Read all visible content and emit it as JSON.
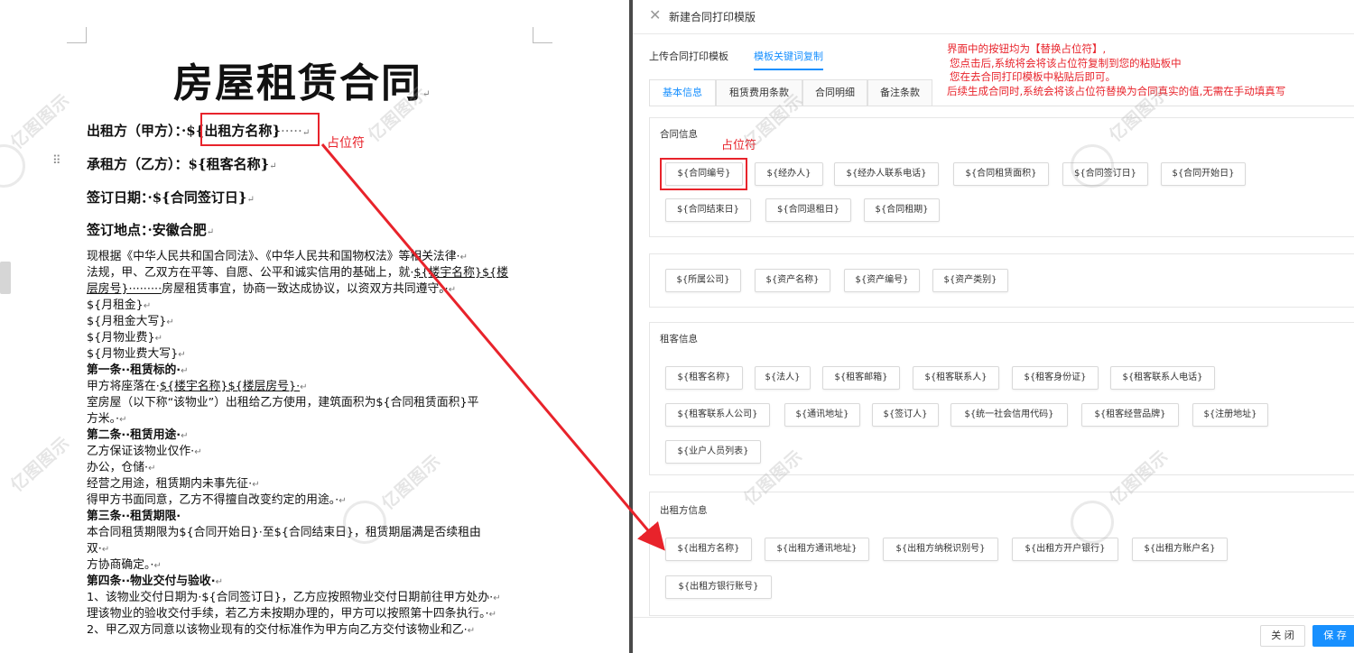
{
  "document": {
    "title": "房屋租赁合同",
    "para_mark": "↵",
    "drag_handle": "⠿",
    "lessor_label": "出租方（甲方）：",
    "lessor_value": "${出租方名称}",
    "lessor_dots": "·····",
    "lessee_label": "承租方（乙方）：",
    "lessee_value": "${租客名称}",
    "sign_date_label": "签订日期：",
    "sign_date_value": "${合同签订日}",
    "sign_place_label": "签订地点：",
    "sign_place_value": "安徽合肥",
    "placeholder_note": "占位符",
    "body": {
      "l1": "现根据《中华人民共和国合同法》、《中华人民共和国物权法》等相关法律·",
      "l2a": "法规，甲、乙双方在平等、自愿、公平和诚实信用的基础上，就·",
      "l2b": "${楼宇名称}${楼",
      "l3a": "层房号}·········",
      "l3b": "房屋租赁事宜，协商一致达成协议，以资双方共同遵守。·",
      "l4": "${月租金}",
      "l5": "${月租金大写}",
      "l6": "${月物业费}",
      "l7": "${月物业费大写}",
      "l8": "第一条··租赁标的·",
      "l9a": "甲方将座落在·",
      "l9b": "${楼宇名称}${楼层房号}·",
      "l10": "室房屋（以下称“该物业”）出租给乙方使用，建筑面积为${合同租赁面积}平",
      "l11": "方米。·",
      "l12": "第二条··租赁用途·",
      "l13": "乙方保证该物业仅作·",
      "l14": "办公，仓储·",
      "l15": "经营之用途，租赁期内未事先征·",
      "l16": "得甲方书面同意，乙方不得擅自改变约定的用途。·",
      "l17": "第三条··租赁期限·",
      "l18": "本合同租赁期限为${合同开始日}·至${合同结束日}，租赁期届满是否续租由",
      "l19": "双·",
      "l20": "方协商确定。·",
      "l21": "第四条··物业交付与验收·",
      "l22": "1、该物业交付日期为·${合同签订日}，乙方应按照物业交付日期前往甲方处办·",
      "l23": "理该物业的验收交付手续，若乙方未按期办理的，甲方可以按照第十四条执行。·",
      "l24": "2、甲乙双方同意以该物业现有的交付标准作为甲方向乙方交付该物业和乙·"
    }
  },
  "watermark": {
    "text": "亿图图示"
  },
  "dialog": {
    "close_icon": "✕",
    "title": "新建合同打印模版",
    "tabs": [
      "上传合同打印模板",
      "模板关键词复制"
    ],
    "note_lines": [
      "界面中的按钮均为【替换占位符】,",
      "您点击后,系统将会将该占位符复制到您的粘贴板中",
      "您在去合同打印模板中粘贴后即可。",
      "后续生成合同时,系统会将该占位符替换为合同真实的值,无需在手动填真写"
    ],
    "subtabs": [
      "基本信息",
      "租赁费用条款",
      "合同明细",
      "备注条款"
    ],
    "placeholder_note": "占位符",
    "sections": {
      "contract": {
        "title": "合同信息",
        "chips": [
          "${合同编号}",
          "${经办人}",
          "${经办人联系电话}",
          "${合同租赁面积}",
          "${合同签订日}",
          "${合同开始日}",
          "${合同结束日}",
          "${合同退租日}",
          "${合同租期}"
        ]
      },
      "asset": {
        "chips": [
          "${所属公司}",
          "${资产名称}",
          "${资产编号}",
          "${资产类别}"
        ]
      },
      "tenant": {
        "title": "租客信息",
        "chips": [
          "${租客名称}",
          "${法人}",
          "${租客邮箱}",
          "${租客联系人}",
          "${租客身份证}",
          "${租客联系人电话}",
          "${租客联系人公司}",
          "${通讯地址}",
          "${签订人}",
          "${统一社会信用代码}",
          "${租客经营品牌}",
          "${注册地址}",
          "${业户人员列表}"
        ]
      },
      "lessor": {
        "title": "出租方信息",
        "chips": [
          "${出租方名称}",
          "${出租方通讯地址}",
          "${出租方纳税识别号}",
          "${出租方开户银行}",
          "${出租方账户名}",
          "${出租方银行账号}"
        ]
      }
    },
    "footer": {
      "close_label": "关 闭",
      "save_label": "保 存"
    }
  },
  "colors": {
    "accent": "#1890ff",
    "annotation_red": "#e8232b"
  }
}
